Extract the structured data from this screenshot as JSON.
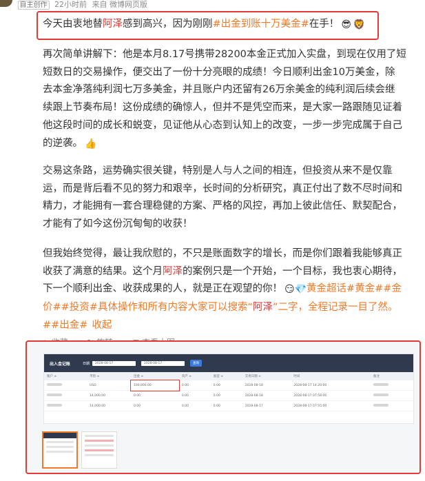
{
  "meta": {
    "tag": "自主创作",
    "time": "22小时前",
    "source": "来自 微博网页版"
  },
  "first_line": {
    "pre": "今天由衷地替",
    "name": "阿泽",
    "mid": "感到高兴，因为刚刚",
    "hashtag": "#出金到账十万美金#",
    "post": "在手！",
    "emoji1": "😎",
    "emoji2": "🦁"
  },
  "para1": {
    "lines": [
      "再次简单讲解下：他是本月8.17号携带28200本金正式加入实盘，到现在仅用了短",
      "短数日的交易操作，便交出了一份十分亮眼的成绩！今日顺利出金10万美金，除",
      "去本金净落纯利润七万多美金，并且账户内还留有26万余美金的纯利润后续会继",
      "续跟上节奏布局！这份成绩的确惊人，但并不是凭空而来，是大家一路跟随见证着",
      "他这段时间的成长和蜕变，见证他从心态到认知上的改变，一步一步完成属于自己"
    ],
    "last": "的逆袭。",
    "emoji": "👍"
  },
  "para2": {
    "lines": [
      "交易这条路，运势确实很关键，特别是人与人之间的相连，但投资从来不是仅靠",
      "运，而是背后看不见的努力和艰辛，长时间的分析研究，真正付出了数不尽时间和",
      "精力，才能拥有一套合理稳健的方案、严格的风控，再加上彼此信任、默契配合，",
      "才能有了如今这份沉甸甸的收获！"
    ]
  },
  "para3": {
    "line1": "但我始终觉得，最让我欣慰的，不只是账面数字的增长，而是你们跟着我能够真正",
    "line2_pre": "收获了满意的结果。这个月",
    "line2_name": "阿泽",
    "line2_post": "的案例只是一个开始，一个目标，我也衷心期待，",
    "line3_pre": "下一个顺利出金、收获成果的人，就是正在观望的你！",
    "line3_emoji": "😏💎",
    "line3_tags": "黄金超话#黄金##金",
    "line4_tags": "价##投资#",
    "line4_text": "具体操作和所有内容大家可以搜索",
    "line4_q1": "“",
    "line4_name": "阿泽",
    "line4_q2": "”二字，全程记录一目了然。",
    "line5_tag": "##出金#",
    "collapse": "收起"
  },
  "actions": {
    "collect": "收藏",
    "rotate": "旋转",
    "view_large": "查看大图"
  },
  "shot": {
    "title": "出入金记账",
    "date_label": "日期",
    "date_from": "2028-08-17",
    "date_to": "2028-08-17",
    "query": "查询",
    "columns": [
      "账户 ≑",
      "币别 ≑",
      "出金 ≑",
      "资产 ≑",
      "类型 ≑",
      "交易日期 ≑",
      "时间",
      "备注"
    ],
    "rows": [
      [
        "",
        "USD",
        "100,000.00",
        "0.00",
        "0.00",
        "2028-08-18",
        "2028-08-17 14:20:00",
        ""
      ],
      [
        "",
        "14,000.00",
        "0.00",
        "0.00",
        "0.00",
        "2028-08-18",
        "2028-08-17 07:58:00",
        ""
      ],
      [
        "",
        "14,000.00",
        "0.00",
        "0.00",
        "0.00",
        "2028-08-17",
        "2028-08-17 07:55:00",
        ""
      ]
    ]
  },
  "colors": {
    "accent_red": "#e53935",
    "accent_orange": "#f07a28",
    "text": "#333333",
    "muted": "#8a8a8a"
  }
}
